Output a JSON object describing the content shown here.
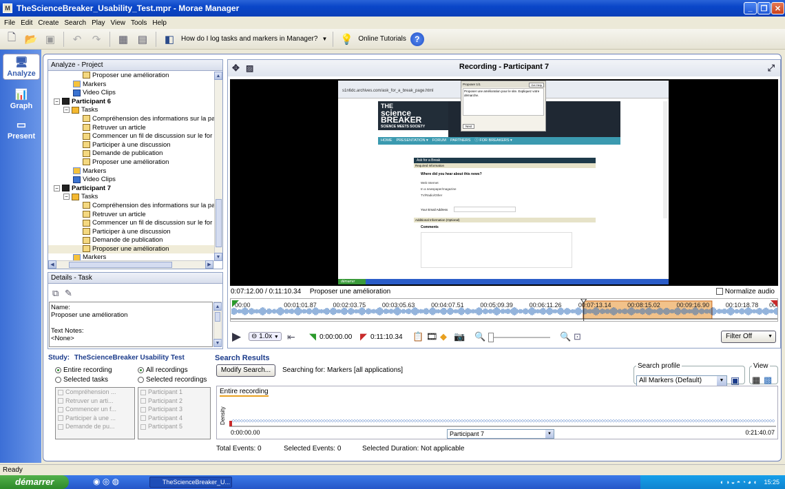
{
  "window": {
    "title": "TheScienceBreaker_Usability_Test.mpr - Morae Manager"
  },
  "menu": [
    "File",
    "Edit",
    "Create",
    "Search",
    "Play",
    "View",
    "Tools",
    "Help"
  ],
  "toolbar": {
    "help_question": "How do I log tasks and markers in Manager?",
    "online_tutorials": "Online Tutorials",
    "help_glyph": "?"
  },
  "rail": {
    "analyze": "Analyze",
    "graph": "Graph",
    "present": "Present"
  },
  "project": {
    "header": "Analyze - Project",
    "rows": [
      {
        "indent": 4,
        "icon": "task",
        "label": "Proposer une amélioration"
      },
      {
        "indent": 3,
        "icon": "flag",
        "label": "Markers"
      },
      {
        "indent": 3,
        "icon": "clip",
        "label": "Video Clips"
      },
      {
        "indent": 1,
        "icon": "part",
        "label": "Participant 6",
        "bold": true,
        "expander": "−"
      },
      {
        "indent": 2,
        "icon": "tasks",
        "label": "Tasks",
        "expander": "−"
      },
      {
        "indent": 4,
        "icon": "task",
        "label": "Compréhension des informations sur la pa"
      },
      {
        "indent": 4,
        "icon": "task",
        "label": "Retruver un article"
      },
      {
        "indent": 4,
        "icon": "task",
        "label": "Commencer un fil de discussion sur le for"
      },
      {
        "indent": 4,
        "icon": "task",
        "label": "Participer à une discussion"
      },
      {
        "indent": 4,
        "icon": "task",
        "label": "Demande de publication"
      },
      {
        "indent": 4,
        "icon": "task",
        "label": "Proposer une amélioration"
      },
      {
        "indent": 3,
        "icon": "flag",
        "label": "Markers"
      },
      {
        "indent": 3,
        "icon": "clip",
        "label": "Video Clips"
      },
      {
        "indent": 1,
        "icon": "part",
        "label": "Participant 7",
        "bold": true,
        "expander": "−"
      },
      {
        "indent": 2,
        "icon": "tasks",
        "label": "Tasks",
        "expander": "−"
      },
      {
        "indent": 4,
        "icon": "task",
        "label": "Compréhension des informations sur la pa"
      },
      {
        "indent": 4,
        "icon": "task",
        "label": "Retruver un article"
      },
      {
        "indent": 4,
        "icon": "task",
        "label": "Commencer un fil de discussion sur le for"
      },
      {
        "indent": 4,
        "icon": "task",
        "label": "Participer à une discussion"
      },
      {
        "indent": 4,
        "icon": "task",
        "label": "Demande de publication"
      },
      {
        "indent": 4,
        "icon": "task",
        "label": "Proposer une amélioration",
        "selected": true
      },
      {
        "indent": 3,
        "icon": "flag",
        "label": "Markers"
      }
    ]
  },
  "details": {
    "header": "Details - Task",
    "name_label": "Name:",
    "name_value": "Proposer une amélioration",
    "notes_label": "Text Notes:",
    "notes_value": "<None>"
  },
  "video": {
    "title": "Recording - Participant 7",
    "timecode": "0:07:12.00 / 0:11:10.34",
    "current_task": "Proposer une amélioration",
    "normalize_audio": "Normalize audio",
    "timeline_ticks": [
      "00:00",
      "00:01:01.87",
      "00:02:03.75",
      "00:03:05.63",
      "00:04:07.51",
      "00:05:09.39",
      "00:06:11.26",
      "00:07:13.14",
      "00:08:15.02",
      "00:09:16.90",
      "00:10:18.78",
      "00"
    ],
    "selection_start": 0.643,
    "selection_end": 0.878,
    "playhead": 0.644,
    "speed": "1.0x",
    "start_time": "0:00:00.00",
    "end_time": "0:11:10.34",
    "filter": "Filter Off"
  },
  "screen": {
    "site_logo_1": "THE",
    "site_logo_2": "science",
    "site_logo_3": "BREAKER",
    "site_logo_4": "SCIENCE MEETS SOCIETY",
    "nav": [
      "HOME",
      "PRESENTATION ▾",
      "FORUM",
      "PARTNERS",
      "ⓘ FOR BREAKERS ▾"
    ],
    "form_title": "Ask for a Break",
    "form_sub": "Required Information",
    "question": "Where did you hear about this news?",
    "options": [
      "Web Internet",
      "In a newspaper/magazine",
      "TV/Radio/Other"
    ],
    "email_label": "Your Email Address",
    "additional": "Additional Information (Optional)",
    "comments": "Comments",
    "dialog_title": "Proposer 1/1",
    "dialog_btn": "Get Help",
    "dialog_text": "Proposer une amélioration pour le site. Expliquez votre démarche.",
    "dialog_ok": "Next",
    "url": "s1n6dc.archives.com/ask_for_a_break_page.html",
    "taskbar": "démarrer"
  },
  "study": {
    "label": "Study:",
    "name": "TheScienceBreaker Usability Test",
    "entire_recording": "Entire recording",
    "selected_tasks": "Selected tasks",
    "all_recordings": "All recordings",
    "selected_recordings": "Selected recordings",
    "tasks_list": [
      "Compréhension ...",
      "Retruver un arti...",
      "Commencer un f...",
      "Participer à une ...",
      "Demande de pu..."
    ],
    "participants_list": [
      "Participant 1",
      "Participant 2",
      "Participant 3",
      "Participant 4",
      "Participant 5"
    ]
  },
  "search": {
    "header": "Search Results",
    "modify": "Modify Search...",
    "searching_for": "Searching for: Markers [all applications]",
    "profile_label": "Search profile",
    "profile_value": "All Markers (Default)",
    "view_label": "View",
    "tab": "Entire recording",
    "density": "Density",
    "start": "0:00:00.00",
    "end": "0:21:40.07",
    "participant": "Participant 7",
    "total_events": "Total Events: 0",
    "selected_events": "Selected Events: 0",
    "selected_duration": "Selected Duration: Not applicable"
  },
  "status": {
    "text": "Ready"
  },
  "taskbar": {
    "start": "démarrer",
    "item": "TheScienceBreaker_U...",
    "clock": "15:25"
  },
  "colors": {
    "selection": "#c8661a",
    "waveform": "#2a6ab8",
    "accent": "#0a46c8"
  }
}
